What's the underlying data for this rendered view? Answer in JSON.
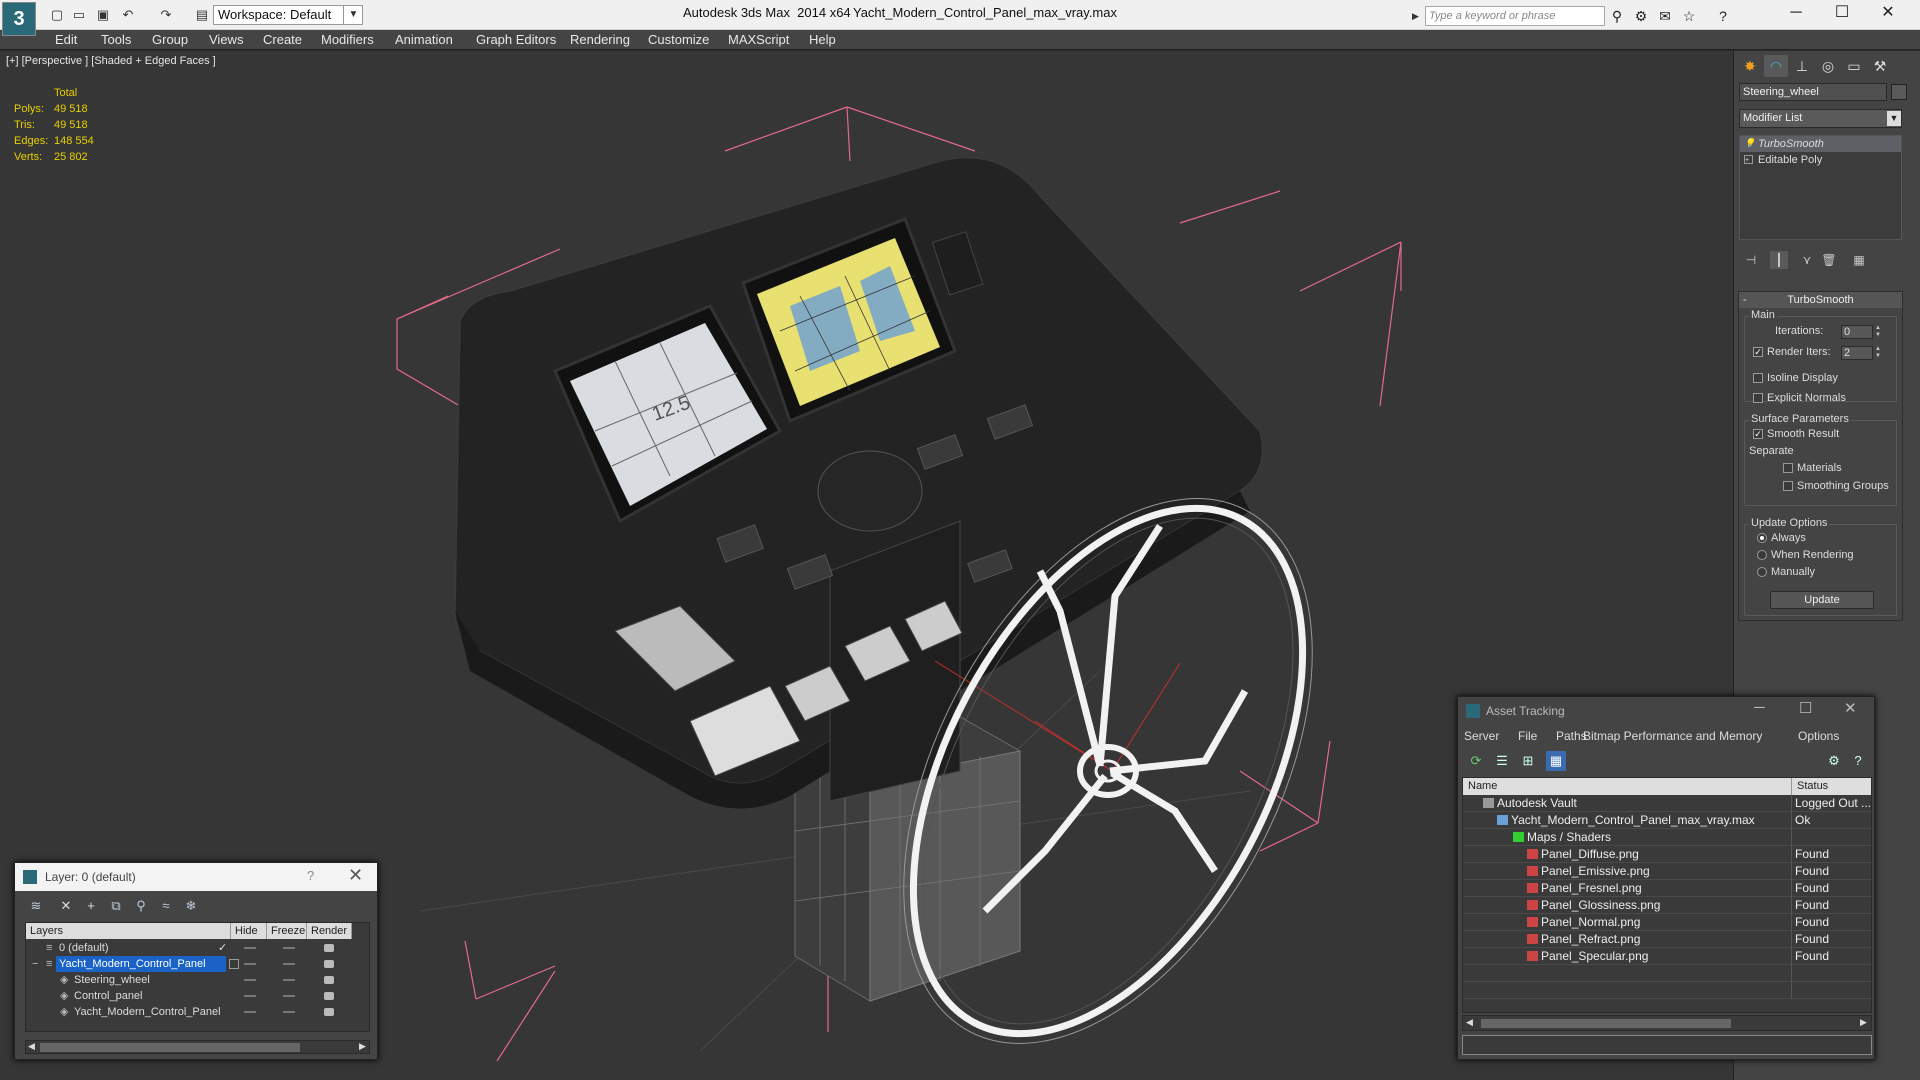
{
  "titlebar": {
    "workspace": "Workspace: Default",
    "app_title": "Autodesk 3ds Max  2014 x64",
    "file_title": "Yacht_Modern_Control_Panel_max_vray.max",
    "search_placeholder": "Type a keyword or phrase"
  },
  "menu": [
    "Edit",
    "Tools",
    "Group",
    "Views",
    "Create",
    "Modifiers",
    "Animation",
    "Graph Editors",
    "Rendering",
    "Customize",
    "MAXScript",
    "Help"
  ],
  "viewport": {
    "label": "[+] [Perspective ] [Shaded + Edged Faces ]",
    "stats": {
      "header": "Total",
      "rows": [
        {
          "label": "Polys:",
          "value": "49 518"
        },
        {
          "label": "Tris:",
          "value": "49 518"
        },
        {
          "label": "Edges:",
          "value": "148 554"
        },
        {
          "label": "Verts:",
          "value": "25 802"
        }
      ]
    }
  },
  "command_panel": {
    "object_name": "Steering_wheel",
    "modifier_list": "Modifier List",
    "stack": [
      "TurboSmooth",
      "Editable Poly"
    ],
    "rollout_title": "TurboSmooth",
    "main_group": "Main",
    "iterations_label": "Iterations:",
    "iterations_value": "0",
    "render_iters_label": "Render Iters:",
    "render_iters_value": "2",
    "isoline_label": "Isoline Display",
    "explicit_normals_label": "Explicit Normals",
    "surface_group": "Surface Parameters",
    "smooth_result_label": "Smooth Result",
    "separate_label": "Separate",
    "materials_label": "Materials",
    "smoothing_groups_label": "Smoothing Groups",
    "update_group": "Update Options",
    "always_label": "Always",
    "when_rendering_label": "When Rendering",
    "manually_label": "Manually",
    "update_button": "Update"
  },
  "layer_dialog": {
    "title": "Layer: 0 (default)",
    "help": "?",
    "columns": [
      "Layers",
      "Hide",
      "Freeze",
      "Render"
    ],
    "rows": [
      {
        "name": "0 (default)"
      },
      {
        "name": "Yacht_Modern_Control_Panel"
      },
      {
        "name": "Steering_wheel"
      },
      {
        "name": "Control_panel"
      },
      {
        "name": "Yacht_Modern_Control_Panel"
      }
    ]
  },
  "asset_tracking": {
    "title": "Asset Tracking",
    "menu": [
      "Server",
      "File",
      "Paths",
      "Bitmap Performance and Memory",
      "Options"
    ],
    "columns": [
      "Name",
      "Status"
    ],
    "rows": [
      {
        "name": "Autodesk Vault",
        "status": "Logged Out ..."
      },
      {
        "name": "Yacht_Modern_Control_Panel_max_vray.max",
        "status": "Ok"
      },
      {
        "name": "Maps / Shaders",
        "status": ""
      },
      {
        "name": "Panel_Diffuse.png",
        "status": "Found"
      },
      {
        "name": "Panel_Emissive.png",
        "status": "Found"
      },
      {
        "name": "Panel_Fresnel.png",
        "status": "Found"
      },
      {
        "name": "Panel_Glossiness.png",
        "status": "Found"
      },
      {
        "name": "Panel_Normal.png",
        "status": "Found"
      },
      {
        "name": "Panel_Refract.png",
        "status": "Found"
      },
      {
        "name": "Panel_Specular.png",
        "status": "Found"
      }
    ]
  },
  "colors": {
    "viewport_bg": "#363636",
    "stats_text": "#e8d000",
    "selection_blue": "#1a62c6",
    "bbox_pink": "#e26a8a"
  }
}
